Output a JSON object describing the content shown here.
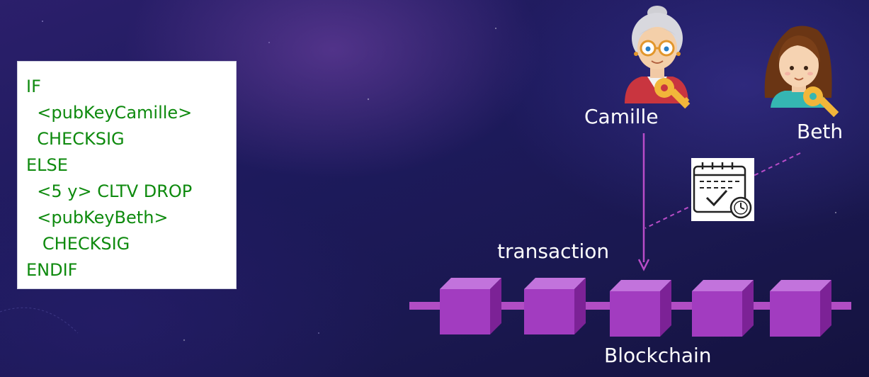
{
  "script": {
    "lines": [
      "IF",
      "  <pubKeyCamille>",
      "  CHECKSIG",
      "ELSE",
      "  <5 y> CLTV DROP",
      "  <pubKeyBeth>",
      "   CHECKSIG",
      "ENDIF"
    ]
  },
  "actors": {
    "camille": "Camille",
    "beth": "Beth"
  },
  "labels": {
    "transaction": "transaction",
    "blockchain": "Blockchain"
  },
  "icons": {
    "camille_avatar": "elderly-woman-icon",
    "beth_avatar": "young-woman-icon",
    "key": "key-icon",
    "timelock": "calendar-clock-icon"
  },
  "colors": {
    "code_text": "#0e8a0e",
    "arrow": "#b84cc8",
    "block": "#a23cc0"
  }
}
